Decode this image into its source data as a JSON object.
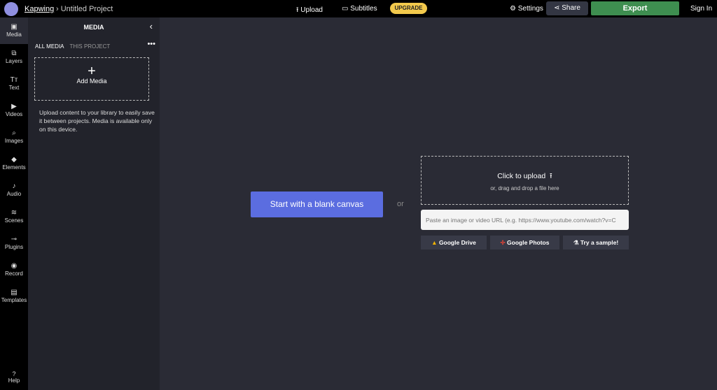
{
  "header": {
    "brand": "Kapwing",
    "separator": "›",
    "project": "Untitled Project",
    "upload": "Upload",
    "subtitles": "Subtitles",
    "upgrade": "UPGRADE",
    "settings": "Settings",
    "share": "Share",
    "export": "Export",
    "signin": "Sign In"
  },
  "rail": [
    {
      "label": "Media",
      "icon": "▣"
    },
    {
      "label": "Layers",
      "icon": "⧉"
    },
    {
      "label": "Text",
      "icon": "Tт"
    },
    {
      "label": "Videos",
      "icon": "▶"
    },
    {
      "label": "Images",
      "icon": "⌕"
    },
    {
      "label": "Elements",
      "icon": "◆"
    },
    {
      "label": "Audio",
      "icon": "♪"
    },
    {
      "label": "Scenes",
      "icon": "≋"
    },
    {
      "label": "Plugins",
      "icon": "⊸"
    },
    {
      "label": "Record",
      "icon": "◉"
    },
    {
      "label": "Templates",
      "icon": "▤"
    }
  ],
  "help": {
    "label": "Help",
    "icon": "?"
  },
  "panel": {
    "title": "MEDIA",
    "tab_all": "ALL MEDIA",
    "tab_project": "THIS PROJECT",
    "add": "Add Media",
    "desc": "Upload content to your library to easily save it between projects. Media is available only on this device."
  },
  "main": {
    "blank": "Start with a blank canvas",
    "or": "or",
    "click_upload": "Click to upload",
    "drag": "or, drag and drop a file here",
    "url_placeholder": "Paste an image or video URL (e.g. https://www.youtube.com/watch?v=C",
    "gdrive": "Google Drive",
    "gphotos": "Google Photos",
    "sample": "Try a sample!"
  }
}
